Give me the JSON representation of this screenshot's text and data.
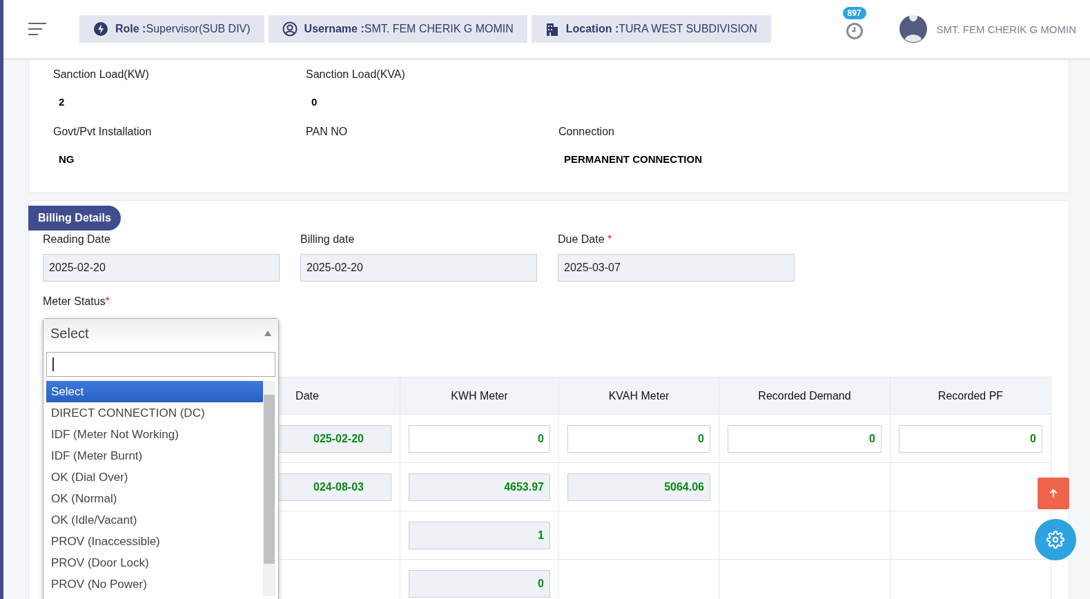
{
  "header": {
    "chips": [
      {
        "kind": "role",
        "label": "Role :",
        "value": "Supervisor(SUB DIV)"
      },
      {
        "kind": "user",
        "label": "Username :",
        "value": "SMT. FEM CHERIK G MOMIN"
      },
      {
        "kind": "location",
        "label": "Location :",
        "value": "TURA WEST SUBDIVISION"
      }
    ],
    "notification_count": "897",
    "user_name": "SMT. FEM CHERIK G MOMIN"
  },
  "consumer_details": {
    "rows": [
      [
        {
          "label": "Sanction Load(KW)",
          "value": "2"
        },
        {
          "label": "Sanction Load(KVA)",
          "value": "0"
        }
      ],
      [
        {
          "label": "Govt/Pvt Installation",
          "value": "NG"
        },
        {
          "label": "PAN NO"
        },
        {
          "label": "Connection",
          "value": "PERMANENT CONNECTION"
        }
      ]
    ]
  },
  "billing": {
    "title": "Billing Details",
    "fields": [
      {
        "label": "Reading Date",
        "value": "2025-02-20"
      },
      {
        "label": "Billing date",
        "value": "2025-02-20"
      },
      {
        "label": "Due Date",
        "value": "2025-03-07",
        "required_mark": "*"
      }
    ],
    "meter_status": {
      "label": "Meter Status",
      "required_mark": "*",
      "value": "Select",
      "options": [
        {
          "label": "Select",
          "selected": true
        },
        {
          "label": "DIRECT CONNECTION (DC)",
          "selected": false
        },
        {
          "label": "IDF (Meter Not Working)",
          "selected": false
        },
        {
          "label": "IDF (Meter Burnt)",
          "selected": false
        },
        {
          "label": "OK (Dial Over)",
          "selected": false
        },
        {
          "label": "OK (Normal)",
          "selected": false
        },
        {
          "label": "OK (Idle/Vacant)",
          "selected": false
        },
        {
          "label": "PROV (Inaccessible)",
          "selected": false
        },
        {
          "label": "PROV (Door Lock)",
          "selected": false
        },
        {
          "label": "PROV (No Power)",
          "selected": false
        }
      ]
    },
    "table": {
      "columns": [
        "Date",
        "KWH Meter",
        "KVAH Meter",
        "Recorded Demand",
        "Recorded PF"
      ],
      "rows": [
        {
          "cells": [
            {
              "kind": "readonly",
              "value": "025-02-20"
            },
            {
              "kind": "input",
              "value": "0"
            },
            {
              "kind": "input",
              "value": "0"
            },
            {
              "kind": "input",
              "value": "0"
            },
            {
              "kind": "input",
              "value": "0"
            }
          ]
        },
        {
          "cells": [
            {
              "kind": "readonly",
              "value": "024-08-03"
            },
            {
              "kind": "readonly",
              "value": "4653.97"
            },
            {
              "kind": "readonly",
              "value": "5064.06"
            },
            {
              "kind": "empty"
            },
            {
              "kind": "empty"
            }
          ]
        },
        {
          "cells": [
            {
              "kind": "empty"
            },
            {
              "kind": "readonly",
              "value": "1"
            },
            {
              "kind": "empty"
            },
            {
              "kind": "empty"
            },
            {
              "kind": "empty"
            }
          ]
        },
        {
          "cells": [
            {
              "kind": "empty"
            },
            {
              "kind": "readonly",
              "value": "0"
            },
            {
              "kind": "empty"
            },
            {
              "kind": "empty"
            },
            {
              "kind": "empty"
            }
          ]
        }
      ]
    }
  }
}
